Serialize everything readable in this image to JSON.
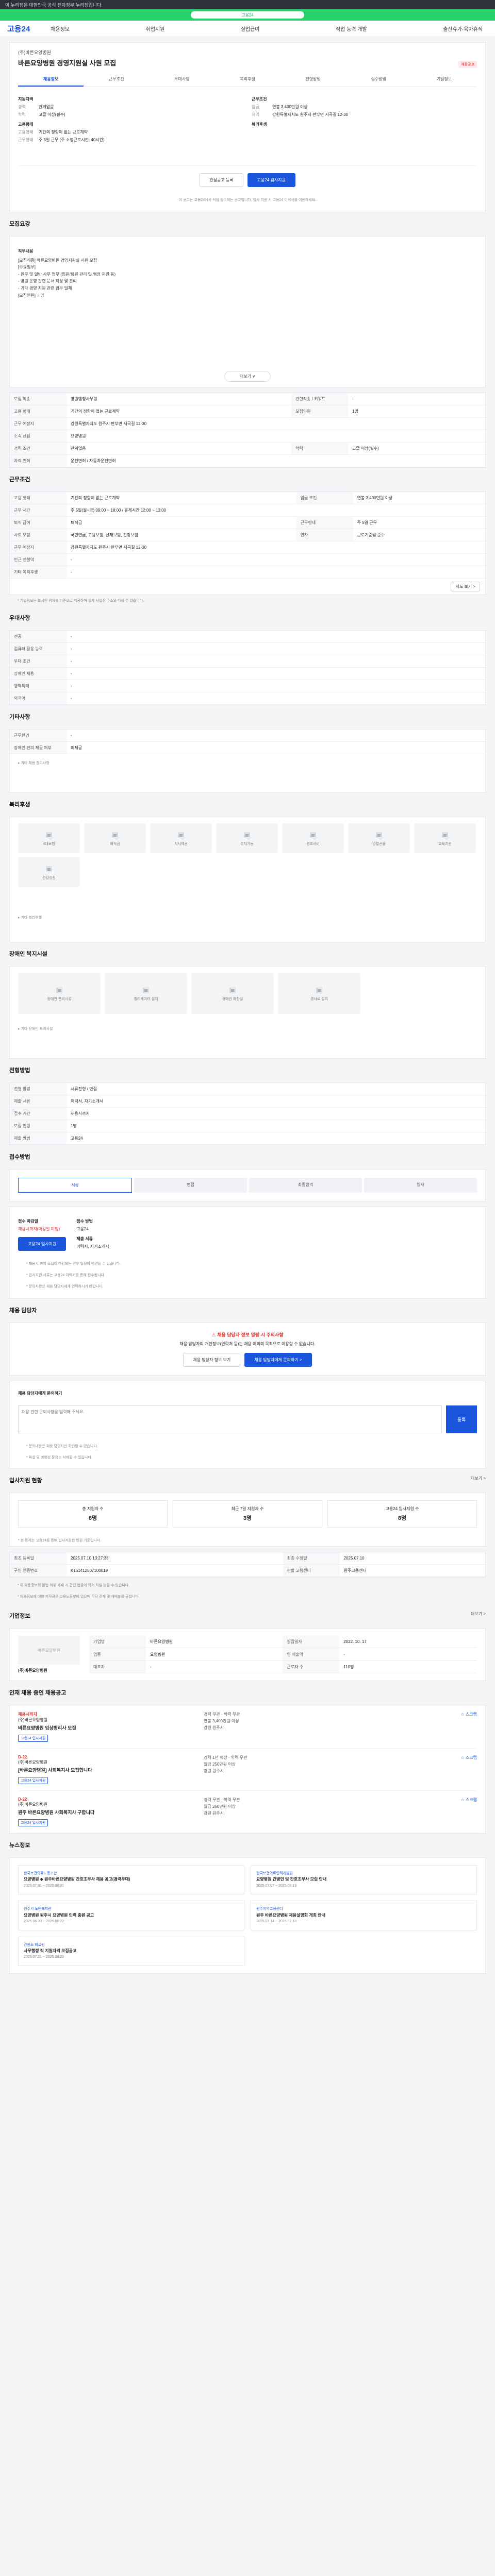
{
  "topbar": {
    "notice": "이 누리집은 대한민국 공식 전자정부 누리집입니다."
  },
  "banner": {
    "label": "고용24"
  },
  "gnb": {
    "logo": "고용24",
    "menu": [
      "채용정보",
      "취업지원",
      "실업급여",
      "직업 능력 개발",
      "출산휴가·육아휴직"
    ]
  },
  "detail_tabs": [
    "채용정보",
    "근무조건",
    "우대사항",
    "복리후생",
    "전형방법",
    "접수방법",
    "기업정보"
  ],
  "job": {
    "company": "(주)바른요양병원",
    "title": "바른요양병원 경영지원실 사원 모집",
    "badge": "채용공고",
    "left_heading": "지원자격",
    "right_heading": "근무조건",
    "left": [
      {
        "k": "경력",
        "v": "관계없음"
      },
      {
        "k": "학력",
        "v": "고졸 이상(필수)"
      }
    ],
    "right": [
      {
        "k": "임금",
        "v": "연봉 3,400만원 이상"
      },
      {
        "k": "지역",
        "v": "강원특별자치도 원주시 판부면 서곡길 12-30"
      }
    ],
    "left2_heading": "고용형태",
    "left2": [
      {
        "k": "고용형태",
        "v": "기간의 정함이 없는 근로계약"
      },
      {
        "k": "근무형태",
        "v": "주 5일 근무 (주 소정근로시간: 40시간)"
      }
    ],
    "right2_heading": "복리후생",
    "scrap_btn": "관심공고 등록",
    "apply_btn": "고용24 입사지원",
    "info_note": "이 공고는 고용24에서 직접 접수되는 공고입니다. 입사 지원 시 고용24 이력서를 이용하세요."
  },
  "sections": {
    "recruit_title": "모집요강",
    "condition_title": "근무조건",
    "preference_title": "우대사항",
    "other_title": "기타사항",
    "welfare_title": "복리후생",
    "disability_title": "장애인 복지시설",
    "process_title": "전형방법",
    "apply_title": "접수방법",
    "manager_title": "채용 담당자",
    "stats_title": "입사지원 현황",
    "company_title": "기업정보",
    "related_title": "인재 채용 중인 채용공고",
    "news_title": "뉴스정보"
  },
  "recruit_detail": {
    "heading": "직무내용",
    "lines": [
      "[모집직종] 바른요양병원 경영지원실 사원 모집",
      "[주요업무]",
      "- 원무 및 일반 사무 업무 (입원/퇴원 관리 및 행정 지원 등)",
      "- 병원 운영 관련 문서 작성 및 관리",
      "- 기타 경영 지원 관련 업무 일체",
      "[모집인원] ○ 명"
    ],
    "more": "더보기 ∨"
  },
  "recruit_table": [
    {
      "k": "모집 직종",
      "v": "병원행정사무원",
      "k2": "관련직종 / 키워드",
      "v2": "-"
    },
    {
      "k": "고용 형태",
      "v": "기간의 정함이 없는 근로계약",
      "k2": "모집인원",
      "v2": "1명"
    },
    {
      "k": "근무 예정지",
      "v": "강원특별자치도 원주시 판부면 서곡길 12-30",
      "k2": "",
      "v2": ""
    },
    {
      "k": "소속 산업",
      "v": "요양병원",
      "k2": "",
      "v2": ""
    },
    {
      "k": "경력 조건",
      "v": "관계없음",
      "k2": "학력",
      "v2": "고졸 이상(필수)"
    },
    {
      "k": "자격 면허",
      "v": "운전면허 / 자동차운전면허",
      "k2": "",
      "v2": ""
    }
  ],
  "condition_table": [
    {
      "k": "고용 형태",
      "v": "기간의 정함이 없는 근로계약",
      "k2": "임금 조건",
      "v2": "연봉 3,400만원 이상"
    },
    {
      "k": "근무 시간",
      "v": "주 5일(월~금) 09:00 ~ 18:00 / 휴게시간 12:00 ~ 13:00",
      "k2": "",
      "v2": ""
    },
    {
      "k": "퇴직 급여",
      "v": "퇴직금",
      "k2": "근무형태",
      "v2": "주 5일 근무"
    },
    {
      "k": "사회 보험",
      "v": "국민연금, 고용보험, 산재보험, 건강보험",
      "k2": "연차",
      "v2": "근로기준법 준수"
    },
    {
      "k": "근무 예정지",
      "v": "강원특별자치도 원주시 판부면 서곡길 12-30",
      "k2": "",
      "v2": ""
    },
    {
      "k": "인근 전철역",
      "v": "-",
      "k2": "",
      "v2": ""
    },
    {
      "k": "기타 복리후생",
      "v": "-",
      "k2": "",
      "v2": ""
    }
  ],
  "condition_note": "* 기업정보는 표시된 위치를 기준으로 제공하며 실제 사업장 주소와 다를 수 있습니다.",
  "map_btn": "지도 보기 >",
  "preference_table": [
    {
      "k": "전공",
      "v": "-"
    },
    {
      "k": "컴퓨터 활용 능력",
      "v": "-"
    },
    {
      "k": "우대 조건",
      "v": "-"
    },
    {
      "k": "장애인 채용",
      "v": "-"
    },
    {
      "k": "병역특례",
      "v": "-"
    },
    {
      "k": "외국어",
      "v": "-"
    }
  ],
  "other_table": [
    {
      "k": "근무환경",
      "v": "-"
    },
    {
      "k": "장애인 편의 제공 여부",
      "v": "미제공"
    }
  ],
  "other_extra": "기타 채용 참고사항",
  "welfare": [
    "4대보험",
    "퇴직금",
    "식사제공",
    "주차가능",
    "경조사비",
    "명절선물",
    "교육지원",
    "건강검진"
  ],
  "welfare_more": "기타 복리후생",
  "disability": [
    "장애인 편의시설",
    "엘리베이터 설치",
    "장애인 화장실",
    "경사로 설치"
  ],
  "disability_more": "기타 장애인 복지시설",
  "process_table": [
    {
      "k": "전형 방법",
      "v": "서류전형 / 면접"
    },
    {
      "k": "제출 서류",
      "v": "이력서, 자기소개서"
    },
    {
      "k": "접수 기간",
      "v": "채용시까지"
    },
    {
      "k": "모집 인원",
      "v": "1명"
    },
    {
      "k": "제출 방법",
      "v": "고용24"
    }
  ],
  "steps": [
    "서류",
    "면접",
    "최종합격",
    "입사"
  ],
  "apply": {
    "deadline_label": "접수 마감일",
    "deadline": "채용시까지(마감일 미정)",
    "method_label": "접수 방법",
    "method": "고용24",
    "apply_btn": "고용24 입사지원",
    "doc_label": "제출 서류",
    "doc": "이력서, 자기소개서",
    "notes": [
      "* 채용시 까지 모집이 마감되는 경우 일정이 변경될 수 있습니다.",
      "* 입사지원 서류는 고용24 이력서를 통해 접수됩니다.",
      "* 문의사항은 채용 담당자에게 연락하시기 바랍니다."
    ]
  },
  "manager": {
    "warn_title": "채용 담당자 정보 열람 시 주의사항",
    "warn_text": "채용 담당자의 개인정보(연락처 등)는 채용 이외의 목적으로 이용할 수 없습니다.",
    "btn1": "채용 담당자 정보 보기",
    "btn2": "채용 담당자에게 문의하기 >",
    "inquiry_label": "채용 담당자에게 문의하기",
    "inquiry_placeholder": "채용 관련 문의사항을 입력해 주세요.",
    "inquiry_btn": "등록",
    "inquiry_notes": [
      "* 문의내용은 채용 담당자만 확인할 수 있습니다.",
      "* 욕설 및 비방성 문의는 삭제될 수 있습니다."
    ]
  },
  "stats": [
    {
      "label": "총 지원자 수",
      "value": "8명"
    },
    {
      "label": "최근 7일 지원자 수",
      "value": "3명"
    },
    {
      "label": "고용24 입사지원 수",
      "value": "8명"
    }
  ],
  "stats_more": "더보기 >",
  "stats_note": "* 본 통계는 고용24를 통해 입사지원한 인원 기준입니다.",
  "register_table": [
    {
      "k": "최초 등록일",
      "v": "2025.07.10 13:27:33",
      "k2": "최종 수정일",
      "v2": "2025.07.10"
    },
    {
      "k": "구인 인증번호",
      "v": "K151412507100019",
      "k2": "관할 고용센터",
      "v2": "원주고용센터"
    }
  ],
  "register_notes": [
    "* 위 채용정보의 불법·허위 게재 시 관련 법률에 의거 처벌 받을 수 있습니다.",
    "* 채용정보에 대한 저작권은 고용노동부에 있으며 무단 전재 및 재배포를 금합니다."
  ],
  "company": {
    "logo": "바른요양병원",
    "name": "(주)바른요양병원",
    "rows": [
      {
        "k": "기업명",
        "v": "바른요양병원",
        "k2": "설립일자",
        "v2": "2022. 10. 17"
      },
      {
        "k": "업종",
        "v": "요양병원",
        "k2": "연 매출액",
        "v2": "-"
      },
      {
        "k": "대표자",
        "v": "-",
        "k2": "근로자 수",
        "v2": "110명"
      }
    ],
    "more": "더보기 >"
  },
  "related": [
    {
      "dday": "채용시까지",
      "company": "(주)바른요양병원",
      "title": "바른요양병원 임상병리사 모집",
      "tag": "고용24 입사지원",
      "info": "경력 무관 · 학력 무관",
      "wage": "연봉 3,400만원 이상",
      "region": "강원 원주시",
      "scrap": "스크랩"
    },
    {
      "dday": "D-22",
      "company": "(주)바른요양병원",
      "title": "[바른요양병원] 사회복지사 모집합니다",
      "tag": "고용24 입사지원",
      "info": "경력 1년 이상 · 학력 무관",
      "wage": "월급 250만원 이상",
      "region": "강원 원주시",
      "scrap": "스크랩"
    },
    {
      "dday": "D-22",
      "company": "(주)바른요양병원",
      "title": "원주 바른요양병원 사회복지사 구합니다",
      "tag": "고용24 입사지원",
      "info": "경력 무관 · 학력 무관",
      "wage": "월급 260만원 이상",
      "region": "강원 원주시",
      "scrap": "스크랩"
    }
  ],
  "news": [
    {
      "src": "한국보건의료노동조합",
      "title": "요양병원 ◆ 원주바른요양병원 간호조무사 채용 공고(경력우대)",
      "date": "2025.07.01 ~ 2025.08.31"
    },
    {
      "src": "한국보건의료인력개발원",
      "title": "요양병원 간병인 및 간호조무사 모집 안내",
      "date": "2025.07.07 ~ 2025.08.13"
    },
    {
      "src": "원주시 노인복지관",
      "title": "요양병원 원주시 요양병원 인력 충원 공고",
      "date": "2025.06.30 ~ 2025.08.22"
    },
    {
      "src": "원주지역고용센터",
      "title": "원주 바른요양병원 채용설명회 개최 안내",
      "date": "2025.07.14 ~ 2025.07.18"
    },
    {
      "src": "강원도 의료원",
      "title": "사무행정 직 지원자격 모집공고",
      "date": "2025.07.21 ~ 2025.08.20"
    }
  ]
}
